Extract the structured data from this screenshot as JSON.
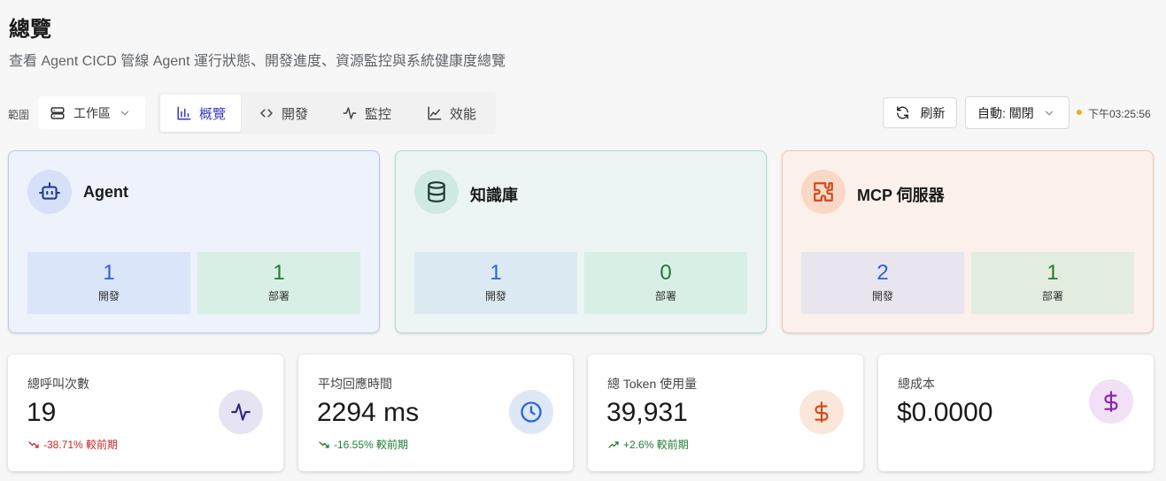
{
  "header": {
    "title": "總覽",
    "subtitle": "查看 Agent CICD 管線 Agent 運行狀態、開發進度、資源監控與系統健康度總覽"
  },
  "toolbar": {
    "scope_label": "範圍",
    "scope_value": "工作區",
    "tabs": [
      {
        "label": "概覽",
        "icon": "bar-chart-icon",
        "active": true
      },
      {
        "label": "開發",
        "icon": "code-icon",
        "active": false
      },
      {
        "label": "監控",
        "icon": "activity-icon",
        "active": false
      },
      {
        "label": "效能",
        "icon": "line-chart-icon",
        "active": false
      }
    ],
    "refresh_label": "刷新",
    "auto_refresh_value": "自動: 關閉",
    "last_updated": "下午03:25:56",
    "status_color": "#f0ad1c"
  },
  "resources": [
    {
      "title": "Agent",
      "icon": "robot-icon",
      "dev_value": "1",
      "dev_label": "開發",
      "deployed_value": "1",
      "deployed_label": "部署",
      "bg": "#edf2fb",
      "border": "#b9c9ea",
      "accent": "#2a3c8e"
    },
    {
      "title": "知識庫",
      "icon": "database-icon",
      "dev_value": "1",
      "dev_label": "開發",
      "deployed_value": "0",
      "deployed_label": "部署",
      "bg": "#ecf5f3",
      "border": "#a9ddd3",
      "accent": "#1f3b38"
    },
    {
      "title": "MCP 伺服器",
      "icon": "puzzle-icon",
      "dev_value": "2",
      "dev_label": "開發",
      "deployed_value": "1",
      "deployed_label": "部署",
      "bg": "#fbf0ea",
      "border": "#f0c9b4",
      "accent": "#d2491f"
    }
  ],
  "metrics": [
    {
      "label": "總呼叫次數",
      "value": "19",
      "trend": "-38.71% 較前期",
      "trend_color": "#c62828",
      "icon": "activity-icon"
    },
    {
      "label": "平均回應時間",
      "value": "2294 ms",
      "trend": "-16.55% 較前期",
      "trend_color": "#1e7d32",
      "icon": "clock-icon"
    },
    {
      "label": "總 Token 使用量",
      "value": "39,931",
      "trend": "+2.6% 較前期",
      "trend_color": "#1e7d32",
      "icon": "dollar-icon"
    },
    {
      "label": "總成本",
      "value": "$0.0000",
      "trend": "",
      "icon": "dollar-icon"
    }
  ]
}
